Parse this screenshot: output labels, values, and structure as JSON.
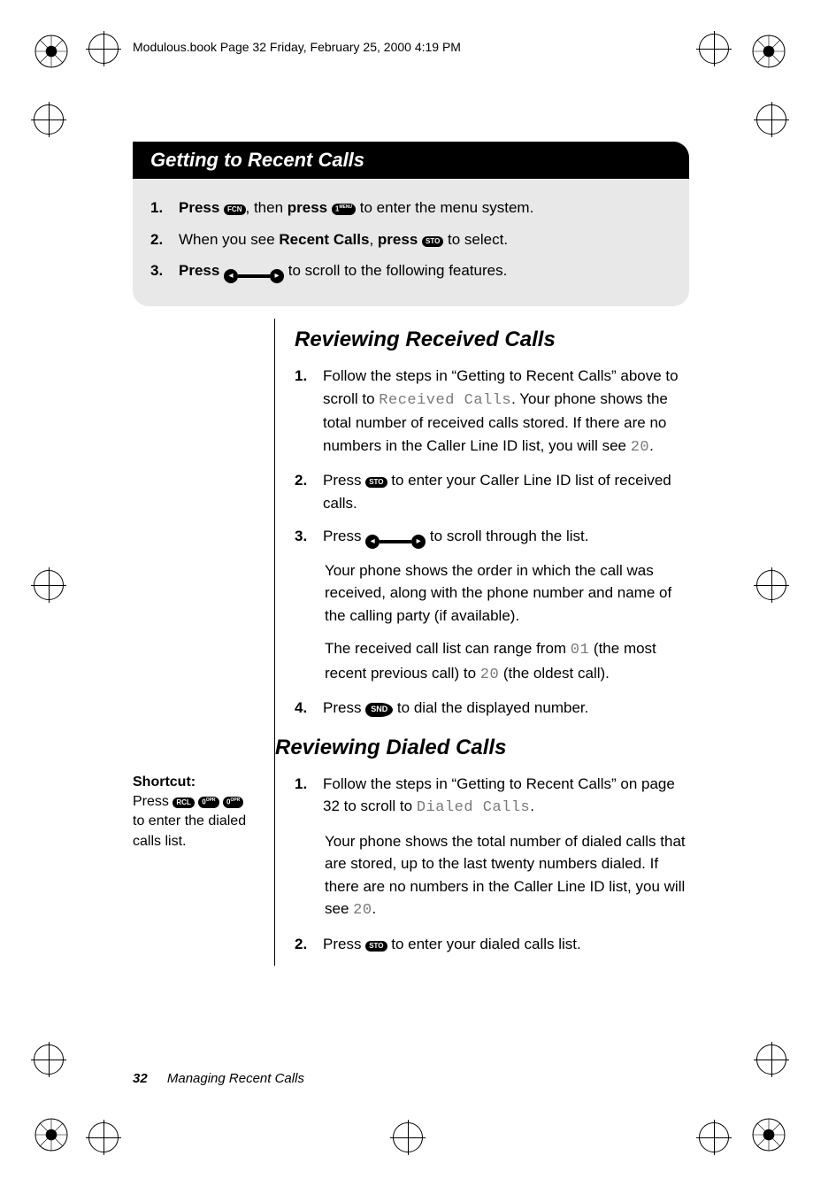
{
  "meta": {
    "runningHeader": "Modulous.book  Page 32  Friday, February 25, 2000  4:19 PM"
  },
  "heading1": "Getting to Recent Calls",
  "intro": {
    "step1_a": "Press ",
    "step1_b": ", then ",
    "step1_c": "press ",
    "step1_d": " to enter the menu system.",
    "step2_a": "When you see ",
    "step2_b": "Recent Calls",
    "step2_c": ", ",
    "step2_d": "press ",
    "step2_e": " to select.",
    "step3_a": "Press ",
    "step3_b": " to scroll to the following features."
  },
  "icons": {
    "fcn": "FCN",
    "menu1": "1",
    "menu1sup": "MENU",
    "sto": "STO",
    "rcl": "RCL",
    "zero": "0",
    "zerosup": "OPR",
    "snd": "SND",
    "left": "◂",
    "right": "▸"
  },
  "sectionA": {
    "title": "Reviewing Received Calls",
    "s1a": "Follow the steps in “Getting to Recent Calls” above to scroll to ",
    "s1lcd": "Received Calls",
    "s1b": ". Your phone shows the total number of received calls stored. If there are no numbers in the Caller Line ID list, you will see ",
    "s1lcd2": "20",
    "s1c": ".",
    "s2a": "Press ",
    "s2b": " to enter your Caller Line ID list of received calls.",
    "s3a": "Press ",
    "s3b": " to scroll through the list.",
    "p1": "Your phone shows the order in which the call was received, along with the phone number and name of the calling party (if available).",
    "p2a": "The received call list can range from ",
    "p2lcd1": "01",
    "p2b": " (the most recent previous call) to ",
    "p2lcd2": "20",
    "p2c": " (the oldest call).",
    "s4a": "Press ",
    "s4b": " to dial the displayed number."
  },
  "sectionB": {
    "title": "Reviewing Dialed Calls",
    "shortcut_label": "Shortcut:",
    "shortcut_a": "Press ",
    "shortcut_b": " to enter the dialed calls list.",
    "s1a": "Follow the steps in “Getting to Recent Calls” on page 32 to scroll to ",
    "s1lcd": "Dialed Calls",
    "s1b": ".",
    "p1a": "Your phone shows the total number of dialed calls that are stored, up to the last twenty numbers dialed. If there are no numbers in the Caller Line ID list, you will see ",
    "p1lcd": "20",
    "p1b": ".",
    "s2a": "Press ",
    "s2b": " to enter your dialed calls list."
  },
  "footer": {
    "page": "32",
    "chapter": "Managing Recent Calls"
  }
}
